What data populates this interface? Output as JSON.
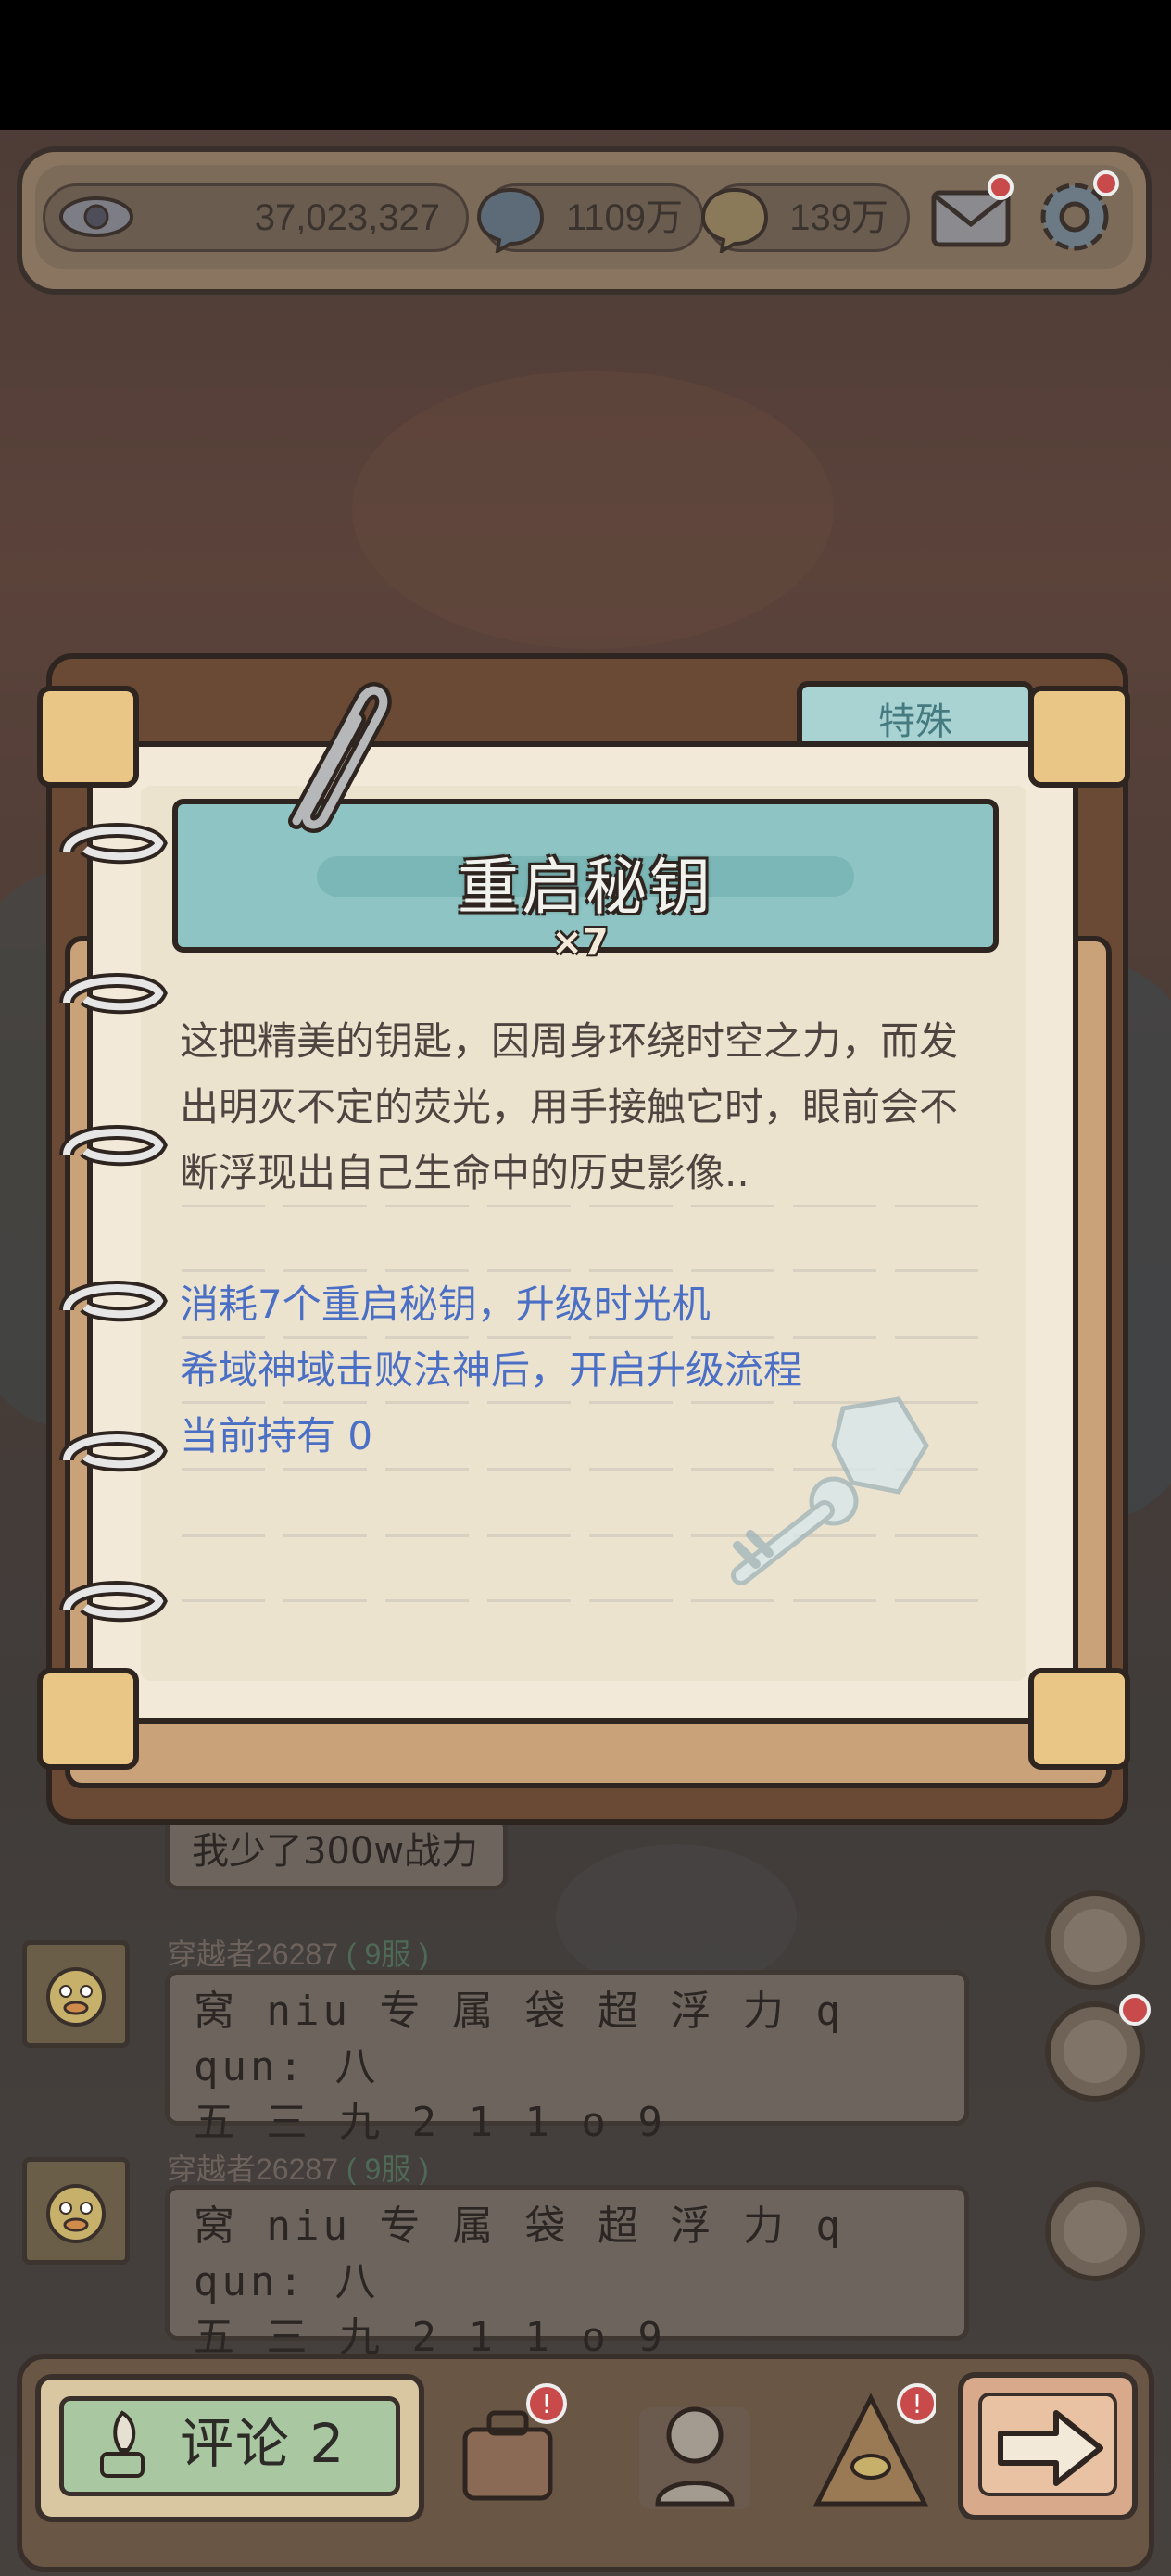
{
  "top_bar": {
    "views_value": "37,023,327",
    "blue_currency": "1109万",
    "gold_currency": "139万"
  },
  "modal": {
    "tab_label": "特殊",
    "title": "重启秘钥",
    "count": "×7",
    "description": "这把精美的钥匙，因周身环绕时空之力，而发出明灭不定的荧光，用手接触它时，眼前会不断浮现出自己生命中的历史影像..",
    "info_line1": "消耗7个重启秘钥，升级时光机",
    "info_line2": "希域神域击败法神后，开启升级流程",
    "info_line3": "当前持有  0"
  },
  "chat": {
    "partial_message": "我少了300w战力",
    "messages": [
      {
        "name": "穿越者26287",
        "server": "9服",
        "line1": "窝 niu 专 属 袋 超 浮 力 q qun: 八",
        "line2": "五 三 九 2 1 1 o 9"
      },
      {
        "name": "穿越者26287",
        "server": "9服",
        "line1": "窝 niu 专 属 袋 超 浮 力 q qun: 八",
        "line2": "五 三 九 2 1 1 o 9"
      }
    ]
  },
  "bottom_bar": {
    "comment_label": "评论 2"
  },
  "colors": {
    "modal_paper": "#f3e9d8",
    "banner_teal": "#8ec5c4",
    "info_blue": "#4b6fc4",
    "notification_red": "#c94a4a"
  }
}
